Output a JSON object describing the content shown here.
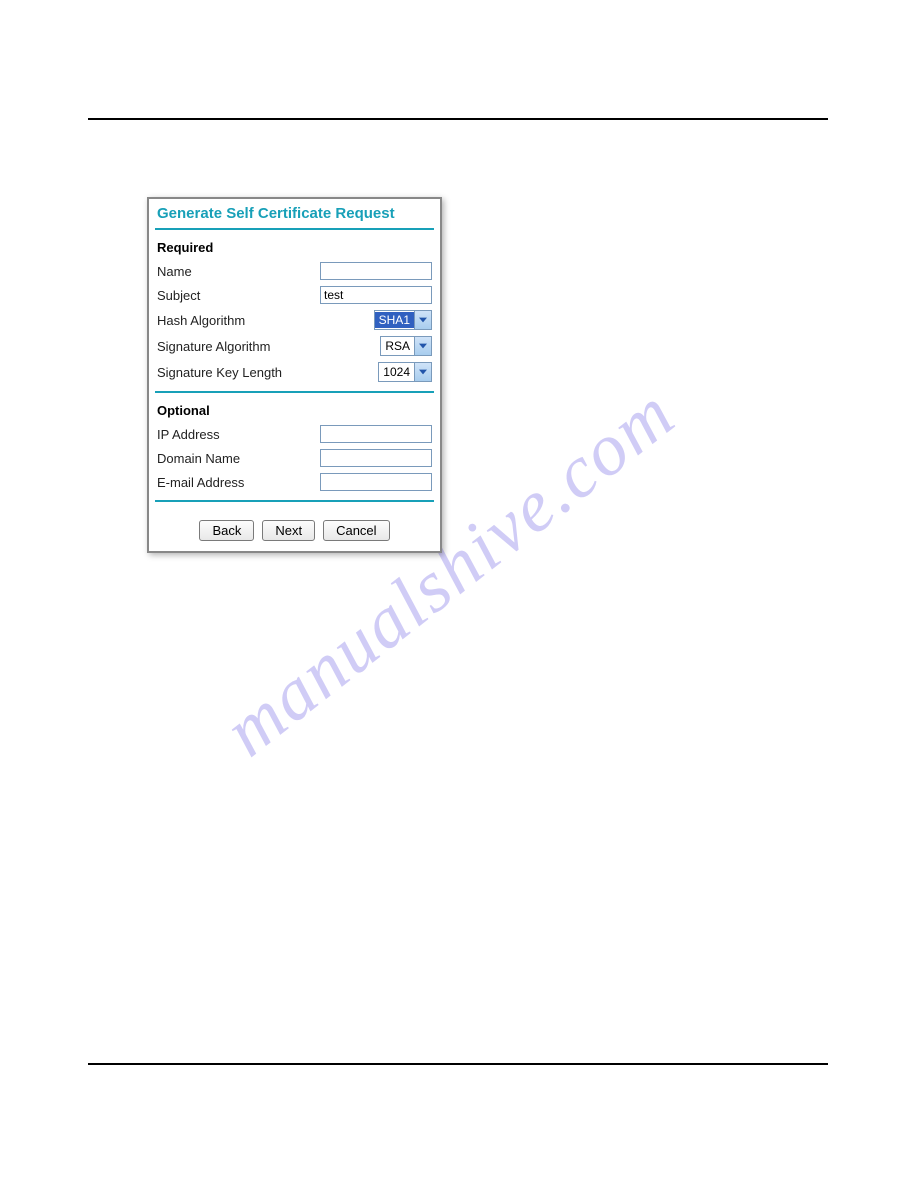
{
  "watermark": "manualshive.com",
  "dialog": {
    "title": "Generate Self Certificate Request",
    "sections": {
      "required": {
        "heading": "Required",
        "fields": {
          "name": {
            "label": "Name",
            "value": ""
          },
          "subject": {
            "label": "Subject",
            "value": "test"
          },
          "hash_algorithm": {
            "label": "Hash Algorithm",
            "value": "SHA1"
          },
          "signature_algorithm": {
            "label": "Signature Algorithm",
            "value": "RSA"
          },
          "signature_key_length": {
            "label": "Signature Key Length",
            "value": "1024"
          }
        }
      },
      "optional": {
        "heading": "Optional",
        "fields": {
          "ip_address": {
            "label": "IP Address",
            "value": ""
          },
          "domain_name": {
            "label": "Domain Name",
            "value": ""
          },
          "email_address": {
            "label": "E-mail Address",
            "value": ""
          }
        }
      }
    },
    "buttons": {
      "back": "Back",
      "next": "Next",
      "cancel": "Cancel"
    }
  }
}
